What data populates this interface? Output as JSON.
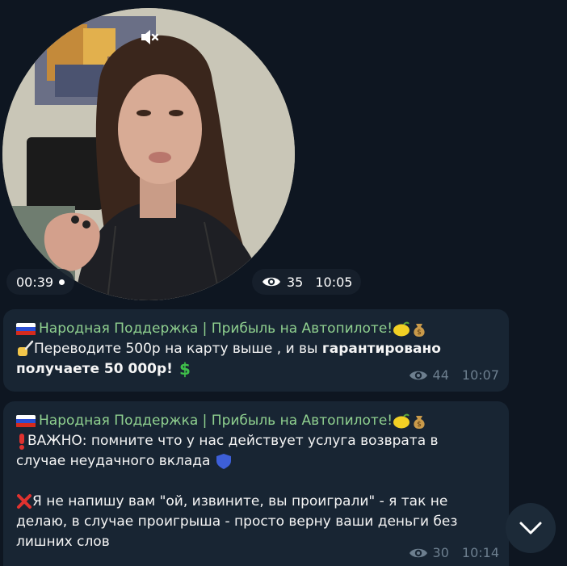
{
  "video_message": {
    "duration": "00:39",
    "views": "35",
    "time": "10:05",
    "icons": {
      "mute": "mute-icon",
      "views": "eye-icon"
    }
  },
  "messages": [
    {
      "sender": "Народная Поддержка | Прибыль на Автопилоте!",
      "line1_plain": "Переводите 500р на карту выше , и вы ",
      "line1_bold": "гарантировано",
      "line2_bold": "получаете 50 000р!",
      "views": "44",
      "time": "10:07"
    },
    {
      "sender": "Народная Поддержка | Прибыль на Автопилоте!",
      "para1_line1": "ВАЖНО: помните что у нас действует услуга возврата в",
      "para1_line2": "случае неудачного вклада",
      "para2_line1": "Я не напишу вам \"ой, извините, вы проиграли\" - я так не",
      "para2_line2": "делаю, в случае проигрыша - просто верну ваши деньги без",
      "para2_line3": "лишних слов",
      "views": "30",
      "time": "10:14"
    }
  ],
  "colors": {
    "background": "#0e1621",
    "bubble": "#182533",
    "sender_name": "#8fd08f",
    "meta_text": "#6d7f8f"
  }
}
